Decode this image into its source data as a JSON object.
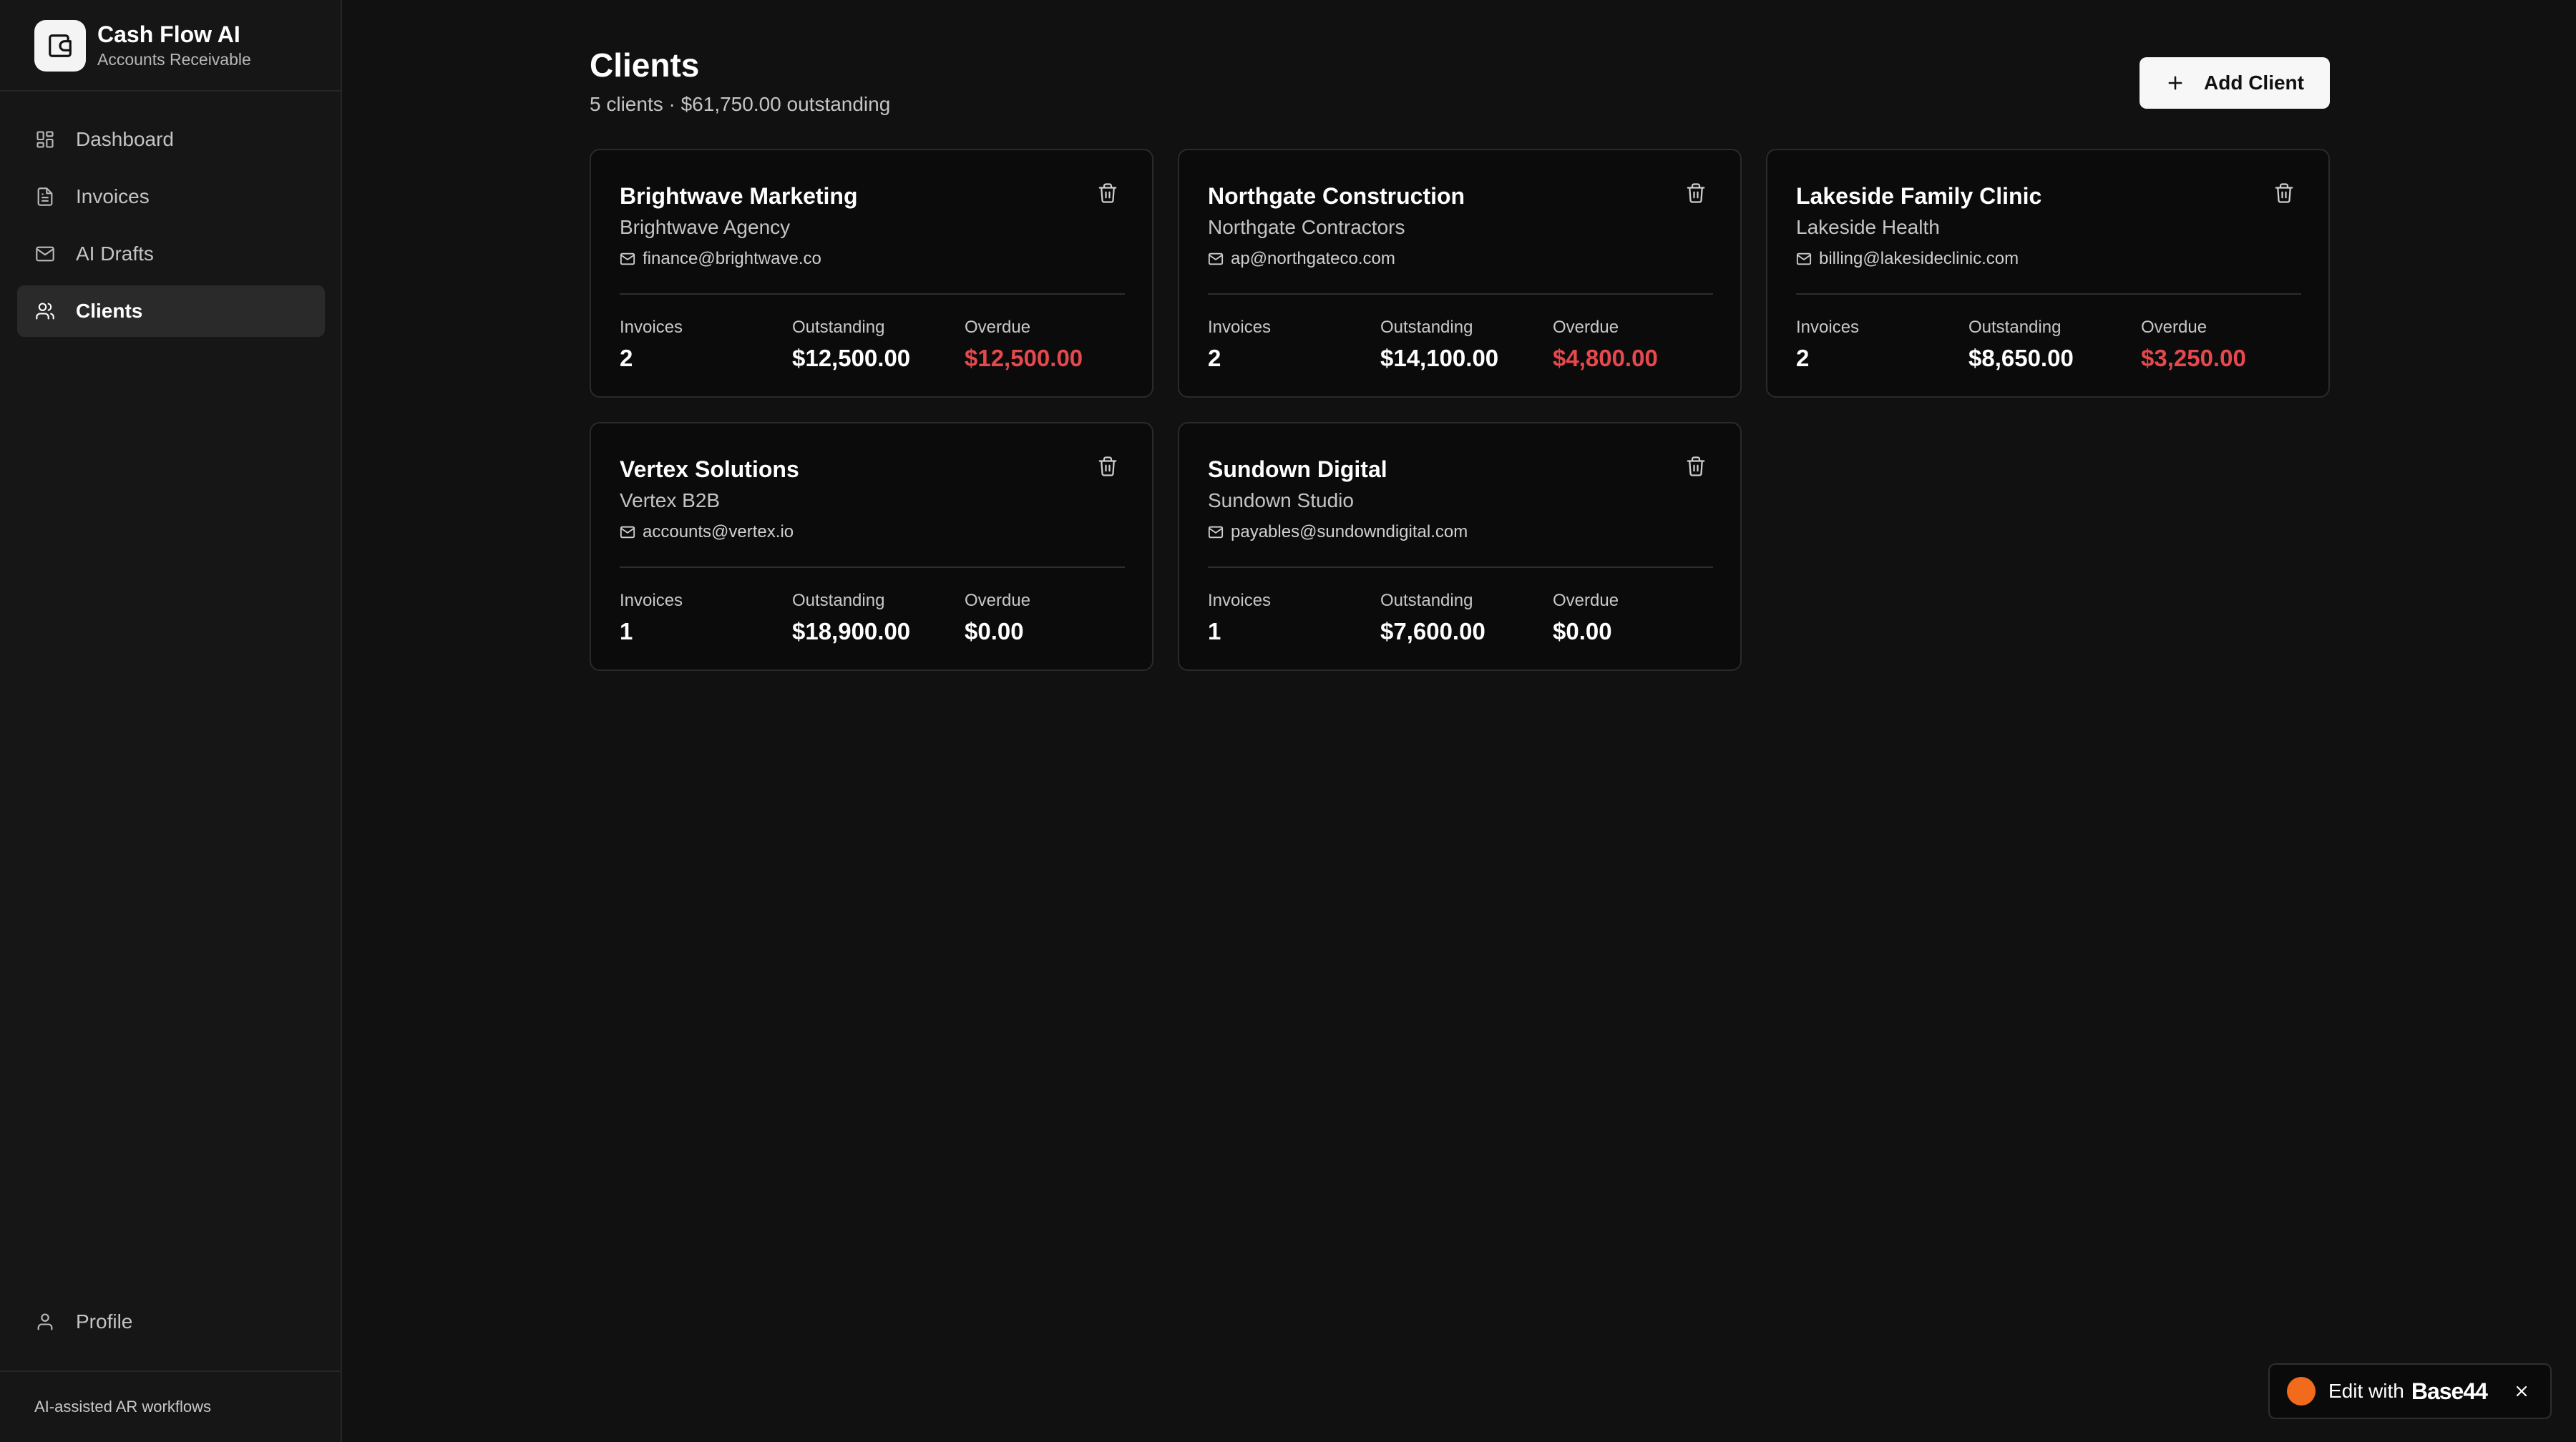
{
  "app": {
    "name": "Cash Flow AI",
    "subtitle": "Accounts Receivable"
  },
  "sidebar": {
    "items": [
      {
        "label": "Dashboard",
        "icon": "dashboard-grid-icon",
        "active": false
      },
      {
        "label": "Invoices",
        "icon": "document-icon",
        "active": false
      },
      {
        "label": "AI Drafts",
        "icon": "mail-icon",
        "active": false
      },
      {
        "label": "Clients",
        "icon": "users-icon",
        "active": true
      }
    ],
    "profile": {
      "label": "Profile",
      "icon": "user-icon"
    },
    "footer": "AI-assisted AR workflows"
  },
  "main": {
    "title": "Clients",
    "subtitle": "5 clients · $61,750.00 outstanding",
    "add_button": {
      "label": "Add Client",
      "icon": "plus-icon"
    }
  },
  "stat_labels": {
    "invoices": "Invoices",
    "outstanding": "Outstanding",
    "overdue": "Overdue"
  },
  "clients": [
    {
      "name": "Brightwave Marketing",
      "company": "Brightwave Agency",
      "email": "finance@brightwave.co",
      "invoices": "2",
      "outstanding": "$12,500.00",
      "overdue": "$12,500.00",
      "overdue_flag": true
    },
    {
      "name": "Northgate Construction",
      "company": "Northgate Contractors",
      "email": "ap@northgateco.com",
      "invoices": "2",
      "outstanding": "$14,100.00",
      "overdue": "$4,800.00",
      "overdue_flag": true
    },
    {
      "name": "Lakeside Family Clinic",
      "company": "Lakeside Health",
      "email": "billing@lakesideclinic.com",
      "invoices": "2",
      "outstanding": "$8,650.00",
      "overdue": "$3,250.00",
      "overdue_flag": true
    },
    {
      "name": "Vertex Solutions",
      "company": "Vertex B2B",
      "email": "accounts@vertex.io",
      "invoices": "1",
      "outstanding": "$18,900.00",
      "overdue": "$0.00",
      "overdue_flag": false
    },
    {
      "name": "Sundown Digital",
      "company": "Sundown Studio",
      "email": "payables@sundowndigital.com",
      "invoices": "1",
      "outstanding": "$7,600.00",
      "overdue": "$0.00",
      "overdue_flag": false
    }
  ],
  "edit_badge": {
    "text": "Edit with",
    "brand": "Base44",
    "close_icon": "close-icon"
  },
  "colors": {
    "background": "#111111",
    "sidebar": "#161616",
    "card": "#0b0b0b",
    "overdue": "#e5484d",
    "badge_dot": "#f26a1b"
  }
}
